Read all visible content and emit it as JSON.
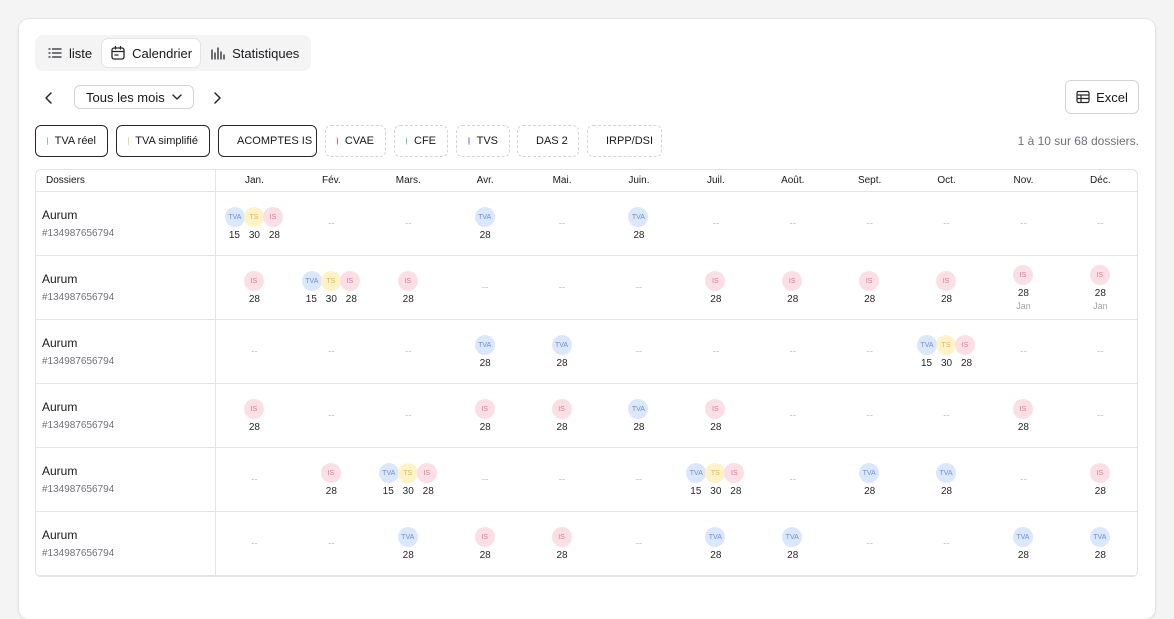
{
  "view_tabs": [
    {
      "label": "liste",
      "icon": "list-icon",
      "active": false
    },
    {
      "label": "Calendrier",
      "icon": "calendar-icon",
      "active": true
    },
    {
      "label": "Statistiques",
      "icon": "bar-chart-icon",
      "active": false
    }
  ],
  "month_select": {
    "value": "Tous les mois"
  },
  "excel_button": {
    "label": "Excel",
    "icon": "table-icon"
  },
  "filters": [
    {
      "label": "TVA réel",
      "color": "#8fb0e8",
      "active": true
    },
    {
      "label": "TVA simplifié",
      "color": "#f5d77a",
      "active": true
    },
    {
      "label": "ACOMPTES IS",
      "color": "#f07f9c",
      "active": true
    },
    {
      "label": "CVAE",
      "color": "#e85d5d",
      "active": false
    },
    {
      "label": "CFE",
      "color": "#5fd49a",
      "active": false
    },
    {
      "label": "TVS",
      "color": "#c0a6f0",
      "active": false
    },
    {
      "label": "DAS 2",
      "color": "#1fa8d4",
      "active": false
    },
    {
      "label": "IRPP/DSI",
      "color": "#93a0ad",
      "active": false
    }
  ],
  "results_count": "1 à 10 sur 68 dossiers.",
  "table": {
    "header_dossiers": "Dossiers",
    "months": [
      "Jan.",
      "Fév.",
      "Mars.",
      "Avr.",
      "Mai.",
      "Juin.",
      "Juil.",
      "Août.",
      "Sept.",
      "Oct.",
      "Nov.",
      "Déc."
    ],
    "empty_marker": "--",
    "rows": [
      {
        "name": "Aurum",
        "id": "#134987656794",
        "cells": [
          {
            "b": [
              "TVA",
              "TS",
              "IS"
            ],
            "d": [
              "15",
              "30",
              "28"
            ]
          },
          null,
          null,
          {
            "b": [
              "TVA"
            ],
            "d": [
              "28"
            ]
          },
          null,
          {
            "b": [
              "TVA"
            ],
            "d": [
              "28"
            ]
          },
          null,
          null,
          null,
          null,
          null,
          null
        ]
      },
      {
        "name": "Aurum",
        "id": "#134987656794",
        "cells": [
          {
            "b": [
              "IS"
            ],
            "d": [
              "28"
            ]
          },
          {
            "b": [
              "TVA",
              "TS",
              "IS"
            ],
            "d": [
              "15",
              "30",
              "28"
            ]
          },
          {
            "b": [
              "IS"
            ],
            "d": [
              "28"
            ]
          },
          null,
          null,
          null,
          {
            "b": [
              "IS"
            ],
            "d": [
              "28"
            ]
          },
          {
            "b": [
              "IS"
            ],
            "d": [
              "28"
            ]
          },
          {
            "b": [
              "IS"
            ],
            "d": [
              "28"
            ]
          },
          {
            "b": [
              "IS"
            ],
            "d": [
              "28"
            ]
          },
          {
            "b": [
              "IS"
            ],
            "d": [
              "28"
            ],
            "sub": "Jan"
          },
          {
            "b": [
              "IS"
            ],
            "d": [
              "28"
            ],
            "sub": "Jan"
          }
        ]
      },
      {
        "name": "Aurum",
        "id": "#134987656794",
        "cells": [
          null,
          null,
          null,
          {
            "b": [
              "TVA"
            ],
            "d": [
              "28"
            ]
          },
          {
            "b": [
              "TVA"
            ],
            "d": [
              "28"
            ]
          },
          null,
          null,
          null,
          null,
          {
            "b": [
              "TVA",
              "TS",
              "IS"
            ],
            "d": [
              "15",
              "30",
              "28"
            ]
          },
          null,
          null
        ]
      },
      {
        "name": "Aurum",
        "id": "#134987656794",
        "cells": [
          {
            "b": [
              "IS"
            ],
            "d": [
              "28"
            ]
          },
          null,
          null,
          {
            "b": [
              "IS"
            ],
            "d": [
              "28"
            ]
          },
          {
            "b": [
              "IS"
            ],
            "d": [
              "28"
            ]
          },
          {
            "b": [
              "TVA"
            ],
            "d": [
              "28"
            ]
          },
          {
            "b": [
              "IS"
            ],
            "d": [
              "28"
            ]
          },
          null,
          null,
          null,
          {
            "b": [
              "IS"
            ],
            "d": [
              "28"
            ]
          },
          null
        ]
      },
      {
        "name": "Aurum",
        "id": "#134987656794",
        "cells": [
          null,
          {
            "b": [
              "IS"
            ],
            "d": [
              "28"
            ]
          },
          {
            "b": [
              "TVA",
              "TS",
              "IS"
            ],
            "d": [
              "15",
              "30",
              "28"
            ]
          },
          null,
          null,
          null,
          {
            "b": [
              "TVA",
              "TS",
              "IS"
            ],
            "d": [
              "15",
              "30",
              "28"
            ]
          },
          null,
          {
            "b": [
              "TVA"
            ],
            "d": [
              "28"
            ]
          },
          {
            "b": [
              "TVA"
            ],
            "d": [
              "28"
            ]
          },
          null,
          {
            "b": [
              "IS"
            ],
            "d": [
              "28"
            ]
          }
        ]
      },
      {
        "name": "Aurum",
        "id": "#134987656794",
        "cells": [
          null,
          null,
          {
            "b": [
              "TVA"
            ],
            "d": [
              "28"
            ]
          },
          {
            "b": [
              "IS"
            ],
            "d": [
              "28"
            ]
          },
          {
            "b": [
              "IS"
            ],
            "d": [
              "28"
            ]
          },
          null,
          {
            "b": [
              "TVA"
            ],
            "d": [
              "28"
            ]
          },
          {
            "b": [
              "TVA"
            ],
            "d": [
              "28"
            ]
          },
          null,
          null,
          {
            "b": [
              "TVA"
            ],
            "d": [
              "28"
            ]
          },
          {
            "b": [
              "TVA"
            ],
            "d": [
              "28"
            ]
          }
        ]
      }
    ]
  }
}
